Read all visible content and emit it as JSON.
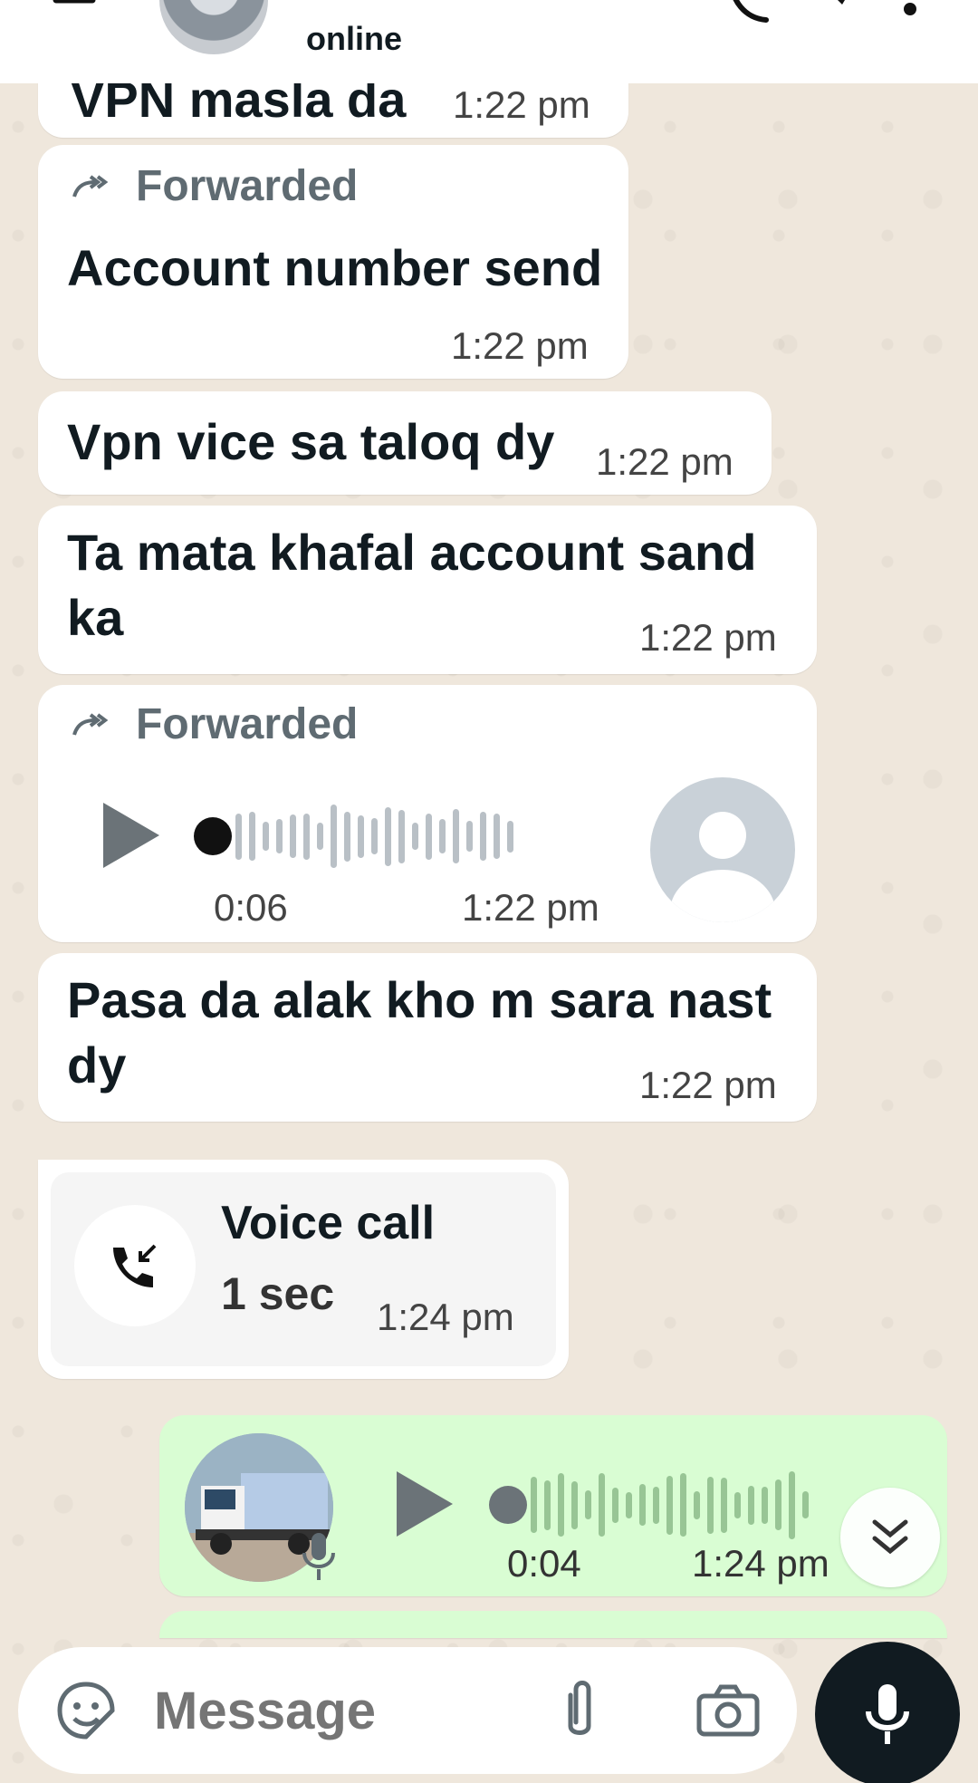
{
  "header": {
    "status": "online",
    "icons": [
      "back-arrow-icon",
      "call-icon",
      "video-icon",
      "more-vert-icon"
    ]
  },
  "messages": [
    {
      "text": "VPN masla da",
      "time": "1:22 pm"
    },
    {
      "forwarded": "Forwarded",
      "text": "Account number send",
      "time": "1:22 pm"
    },
    {
      "text": "Vpn vice sa taloq dy",
      "time": "1:22 pm"
    },
    {
      "text_line1": "Ta mata khafal account sand",
      "text_line2": "ka",
      "time": "1:22 pm"
    },
    {
      "forwarded": "Forwarded",
      "duration": "0:06",
      "time": "1:22 pm",
      "progress": 0
    },
    {
      "text_line1": "Pasa da alak kho m sara nast",
      "text_line2": "dy",
      "time": "1:22 pm"
    }
  ],
  "call": {
    "title": "Voice call",
    "duration": "1 sec",
    "time": "1:24 pm",
    "icon": "incoming-call-icon"
  },
  "outgoing_voice": {
    "duration": "0:04",
    "time": "1:24 pm",
    "progress": 0
  },
  "composer": {
    "placeholder": "Message",
    "icons": [
      "sticker-icon",
      "attach-icon",
      "camera-icon",
      "mic-icon"
    ]
  }
}
